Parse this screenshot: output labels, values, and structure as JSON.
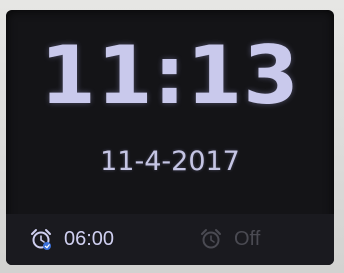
{
  "clock": {
    "time": "11:13",
    "date": "11-4-2017"
  },
  "alarms": [
    {
      "icon": "alarm-clock-active-icon",
      "value": "06:00",
      "active": true
    },
    {
      "icon": "alarm-clock-inactive-icon",
      "value": "Off",
      "active": false
    }
  ],
  "colors": {
    "screen_background": "#141417",
    "text_primary": "#c9c9ec",
    "text_inactive": "#4a4a52",
    "alarm_badge": "#3a6fd8"
  }
}
